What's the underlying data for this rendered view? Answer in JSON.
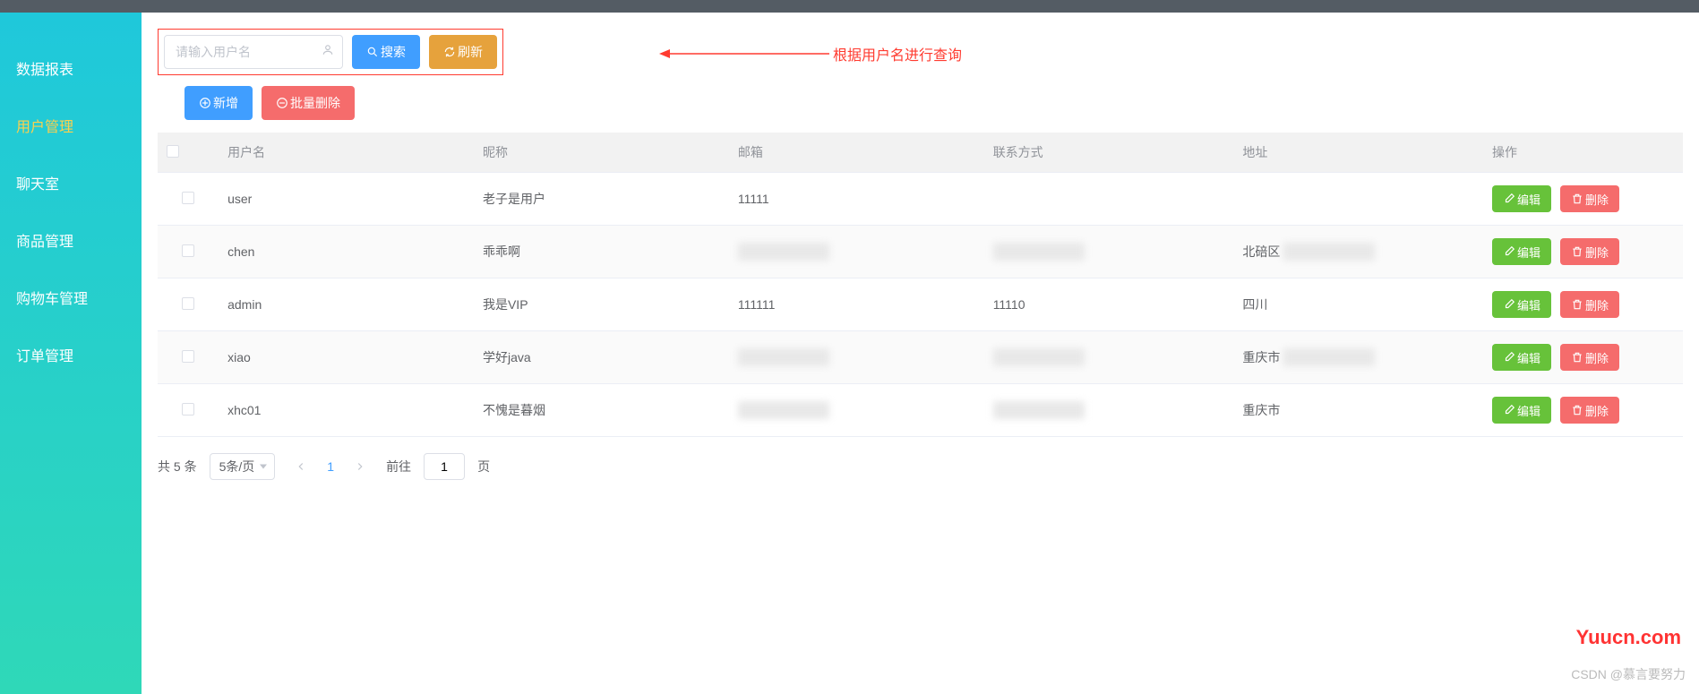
{
  "sidebar": {
    "items": [
      {
        "label": "数据报表"
      },
      {
        "label": "用户管理",
        "active": true
      },
      {
        "label": "聊天室"
      },
      {
        "label": "商品管理"
      },
      {
        "label": "购物车管理"
      },
      {
        "label": "订单管理"
      }
    ]
  },
  "search": {
    "placeholder": "请输入用户名",
    "search_btn": "搜索",
    "refresh_btn": "刷新"
  },
  "annotation": "根据用户名进行查询",
  "actions": {
    "add": "新增",
    "batch_delete": "批量删除"
  },
  "table": {
    "headers": {
      "username": "用户名",
      "nickname": "昵称",
      "email": "邮箱",
      "contact": "联系方式",
      "address": "地址",
      "ops": "操作"
    },
    "rows": [
      {
        "username": "user",
        "nickname": "老子是用户",
        "email": "11111",
        "contact": "",
        "address": "",
        "email_blur": false,
        "contact_blur": false,
        "addr_blur": false
      },
      {
        "username": "chen",
        "nickname": "乖乖啊",
        "email": "",
        "contact": "",
        "address": "北碚区",
        "email_blur": true,
        "contact_blur": true,
        "addr_blur": true
      },
      {
        "username": "admin",
        "nickname": "我是VIP",
        "email": "111111",
        "contact": "11110",
        "address": "四川",
        "email_blur": false,
        "contact_blur": false,
        "addr_blur": false
      },
      {
        "username": "xiao",
        "nickname": "学好java",
        "email": "",
        "contact": "",
        "address": "重庆市",
        "email_blur": true,
        "contact_blur": true,
        "addr_blur": true
      },
      {
        "username": "xhc01",
        "nickname": "不愧是暮烟",
        "email": "",
        "contact": "",
        "address": "重庆市",
        "email_blur": true,
        "contact_blur": true,
        "addr_blur": false
      }
    ],
    "edit_btn": "编辑",
    "delete_btn": "删除"
  },
  "pagination": {
    "total_prefix": "共",
    "total_count": "5",
    "total_suffix": "条",
    "per_page": "5条/页",
    "current": "1",
    "goto_prefix": "前往",
    "goto_value": "1",
    "goto_suffix": "页"
  },
  "watermark1": "Yuucn.com",
  "watermark2": "CSDN @慕言要努力"
}
